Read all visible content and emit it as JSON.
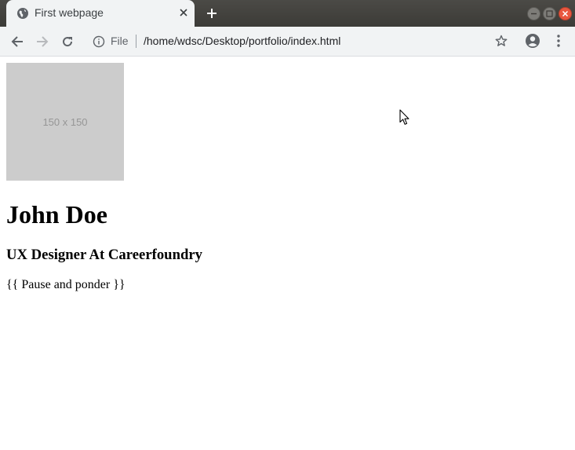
{
  "tab": {
    "title": "First webpage"
  },
  "address_bar": {
    "scheme_label": "File",
    "url": "/home/wdsc/Desktop/portfolio/index.html"
  },
  "page": {
    "placeholder_text": "150 x 150",
    "name": "John Doe",
    "subtitle": "UX Designer At Careerfoundry",
    "paragraph": "{{ Pause and ponder }}"
  },
  "icons": {
    "tab": "globe-icon",
    "tab_close": "close-icon",
    "new_tab": "plus-icon",
    "back": "arrow-left-icon",
    "forward": "arrow-right-icon",
    "reload": "reload-icon",
    "info": "info-icon",
    "bookmark": "star-icon",
    "account": "account-icon",
    "menu": "kebab-menu-icon"
  },
  "colors": {
    "titlebar": "#3c3b37",
    "toolbar": "#f1f3f4",
    "placeholder_bg": "#cccccc",
    "close_button": "#e9573f"
  }
}
